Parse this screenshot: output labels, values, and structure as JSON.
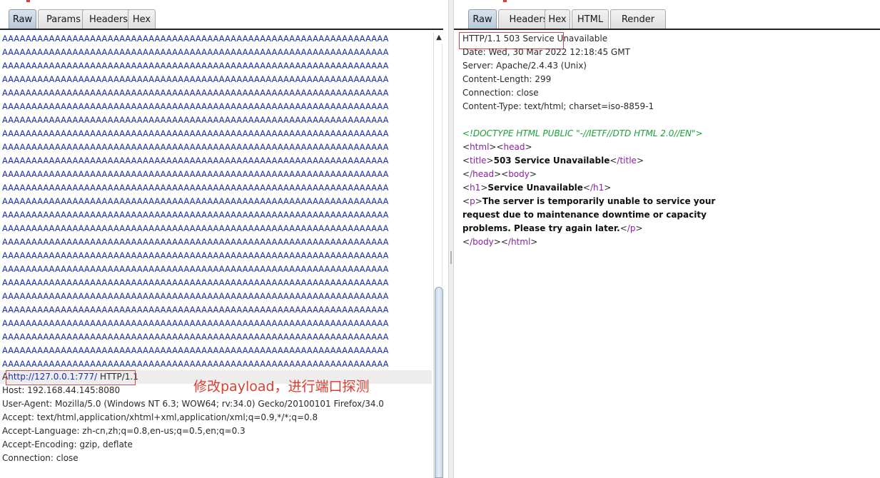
{
  "request_panel": {
    "tabs": [
      "Raw",
      "Params",
      "Headers",
      "Hex"
    ],
    "active_tab": "Raw",
    "payload_line": "AAAAAAAAAAAAAAAAAAAAAAAAAAAAAAAAAAAAAAAAAAAAAAAAAAAAAAAAAAAAAAAAAA",
    "payload_line_count": 25,
    "request_line_prefix": "A",
    "request_url": "http://127.0.0.1:777/",
    "request_protocol": " HTTP/1.1",
    "headers": [
      "Host: 192.168.44.145:8080",
      "User-Agent: Mozilla/5.0 (Windows NT 6.3; WOW64; rv:34.0) Gecko/20100101 Firefox/34.0",
      "Accept: text/html,application/xhtml+xml,application/xml;q=0.9,*/*;q=0.8",
      "Accept-Language: zh-cn,zh;q=0.8,en-us;q=0.5,en;q=0.3",
      "Accept-Encoding: gzip, deflate",
      "Connection: close"
    ],
    "annotation": "修改payload，进行端口探测"
  },
  "response_panel": {
    "tabs": [
      "Raw",
      "Headers",
      "Hex",
      "HTML",
      "Render"
    ],
    "active_tab": "Raw",
    "status_line": "HTTP/1.1 503 Service Unavailable",
    "headers": [
      "Date: Wed, 30 Mar 2022 12:18:45 GMT",
      "Server: Apache/2.4.43 (Unix)",
      "Content-Length: 299",
      "Connection: close",
      "Content-Type: text/html; charset=iso-8859-1"
    ],
    "doctype": "<!DOCTYPE HTML PUBLIC \"-//IETF//DTD HTML 2.0//EN\">",
    "body": {
      "t_html": "html",
      "t_head": "head",
      "t_title": "title",
      "title_text": "503 Service Unavailable",
      "t_close_title": "/title",
      "t_close_head": "/head",
      "t_body": "body",
      "t_h1": "h1",
      "h1_text": "Service Unavailable",
      "t_close_h1": "/h1",
      "t_p": "p",
      "p_line1": "The server is temporarily unable to service your",
      "p_line2": "request due to maintenance downtime or capacity",
      "p_line3": "problems. Please try again later.",
      "t_close_p": "/p",
      "t_close_body": "/body",
      "t_close_html": "/html"
    }
  },
  "colors": {
    "payload_text": "#1b2eb0",
    "annotation": "#e23a2e",
    "tag": "#8a1fa5",
    "doctype": "#1aa03a"
  }
}
